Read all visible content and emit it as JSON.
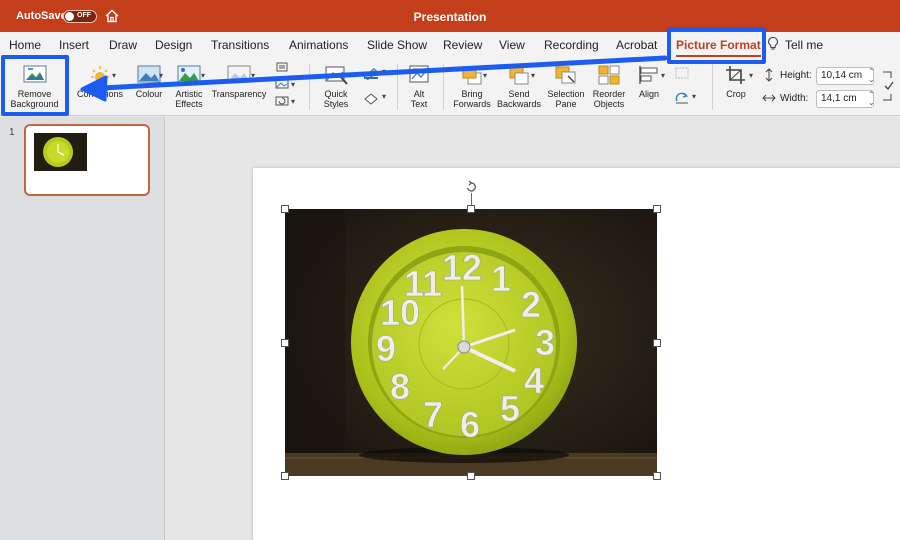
{
  "titlebar": {
    "autosave_label": "AutoSave",
    "autosave_state": "OFF",
    "document_title": "Presentation"
  },
  "tabs": [
    {
      "label": "Home"
    },
    {
      "label": "Insert"
    },
    {
      "label": "Draw"
    },
    {
      "label": "Design"
    },
    {
      "label": "Transitions"
    },
    {
      "label": "Animations"
    },
    {
      "label": "Slide Show"
    },
    {
      "label": "Review"
    },
    {
      "label": "View"
    },
    {
      "label": "Recording"
    },
    {
      "label": "Acrobat"
    },
    {
      "label": "Picture Format",
      "active": true
    }
  ],
  "tell_me": "Tell me",
  "ribbon": {
    "remove_background": [
      "Remove",
      "Background"
    ],
    "corrections": "Corrections",
    "colour": "Colour",
    "artistic_effects": [
      "Artistic",
      "Effects"
    ],
    "transparency": "Transparency",
    "quick_styles": [
      "Quick",
      "Styles"
    ],
    "alt_text": [
      "Alt",
      "Text"
    ],
    "bring_forwards": [
      "Bring",
      "Forwards"
    ],
    "send_backwards": [
      "Send",
      "Backwards"
    ],
    "selection_pane": [
      "Selection",
      "Pane"
    ],
    "reorder_objects": [
      "Reorder",
      "Objects"
    ],
    "align": "Align",
    "crop": "Crop",
    "height_label": "Height:",
    "height_value": "10,14 cm",
    "width_label": "Width:",
    "width_value": "14,1 cm"
  },
  "slides": [
    {
      "number": "1"
    }
  ],
  "clock_numerals": [
    "12",
    "1",
    "2",
    "3",
    "4",
    "5",
    "6",
    "7",
    "8",
    "9",
    "10",
    "11"
  ],
  "colors": {
    "brand": "#c43e1c",
    "annotation": "#1c5cf0",
    "clock_face": "#b5cc1d"
  },
  "icons": {
    "home": "home-icon",
    "lightbulb": "lightbulb-icon",
    "remove_background": "remove-background-icon",
    "corrections": "sun-icon",
    "colour": "colour-icon",
    "artistic_effects": "artistic-effects-icon",
    "transparency": "transparency-icon",
    "quick_styles": "quick-styles-icon",
    "alt_text": "alt-text-icon",
    "crop": "crop-icon"
  }
}
